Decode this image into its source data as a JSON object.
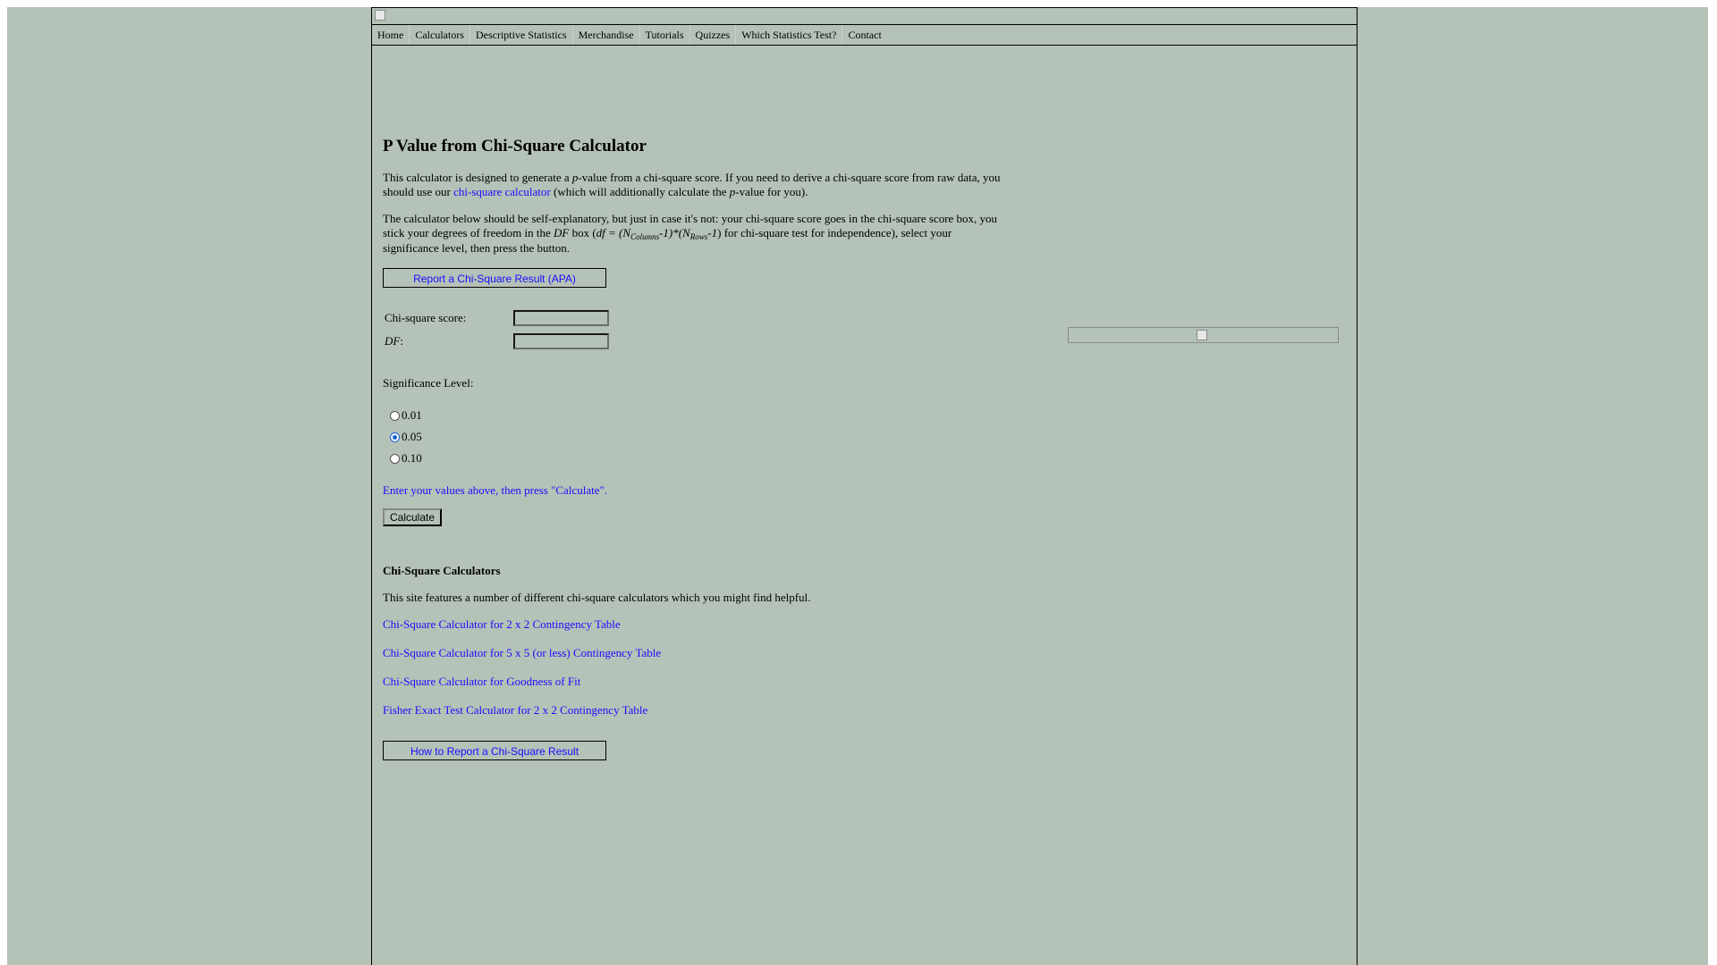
{
  "nav": {
    "items": [
      "Home",
      "Calculators",
      "Descriptive Statistics",
      "Merchandise",
      "Tutorials",
      "Quizzes",
      "Which Statistics Test?",
      "Contact"
    ]
  },
  "main": {
    "title": "P Value from Chi-Square Calculator",
    "intro": {
      "part1": "This calculator is designed to generate a ",
      "p": "p",
      "part2": "-value from a chi-square score. If you need to derive a chi-square score from raw data, you should use our ",
      "link": "chi-square calculator",
      "part3": " (which will additionally calculate the ",
      "part4": "-value for you)."
    },
    "instructions": {
      "part1": "The calculator below should be self-explanatory, but just in case it's not: your chi-square score goes in the chi-square score box, you stick your degrees of freedom in the ",
      "df": "DF",
      "part2": " box (",
      "formula_df": "df",
      "formula_eq": " = (",
      "n1": "N",
      "sub1": "Columns",
      "minus1": "-1)*(",
      "n2": "N",
      "sub2": "Rows",
      "minus2": "-1",
      "part3": ") for chi-square test for independence), select your significance level, then press the button."
    },
    "report_button": "Report a Chi-Square Result (APA)",
    "form": {
      "chi_label": "Chi-square score:",
      "chi_value": "",
      "df_label": "DF",
      "df_colon": ":",
      "df_value": ""
    },
    "significance": {
      "label": "Significance Level:",
      "options": [
        "0.01",
        "0.05",
        "0.10"
      ],
      "selected": "0.05"
    },
    "status": "Enter your values above, then press \"Calculate\".",
    "calculate_button": "Calculate",
    "related": {
      "heading": "Chi-Square Calculators",
      "text": "This site features a number of different chi-square calculators which you might find helpful.",
      "links": [
        "Chi-Square Calculator for 2 x 2 Contingency Table",
        "Chi-Square Calculator for 5 x 5 (or less) Contingency Table",
        "Chi-Square Calculator for Goodness of Fit",
        "Fisher Exact Test Calculator for 2 x 2 Contingency Table"
      ]
    },
    "how_to_button": "How to Report a Chi-Square Result"
  }
}
